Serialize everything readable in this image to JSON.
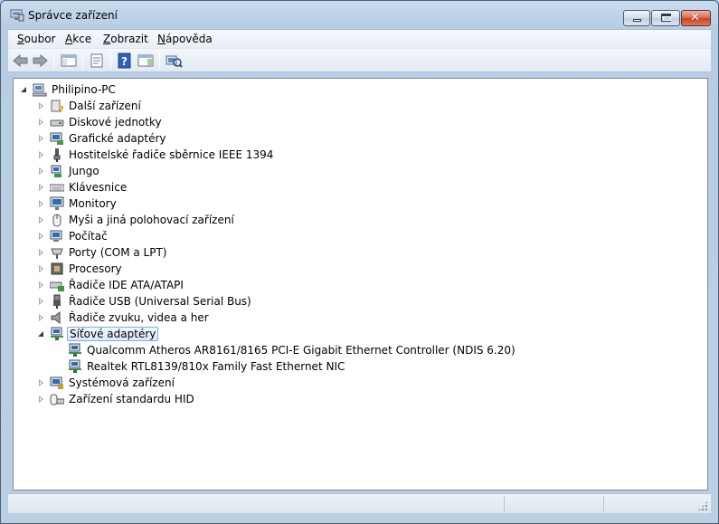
{
  "window": {
    "title": "Správce zařízení",
    "icons": [
      "device-manager-icon",
      "minimize-icon",
      "maximize-icon",
      "close-icon"
    ]
  },
  "menu": {
    "items": [
      {
        "label": "Soubor",
        "accel": "S"
      },
      {
        "label": "Akce",
        "accel": "A"
      },
      {
        "label": "Zobrazit",
        "accel": "Z"
      },
      {
        "label": "Nápověda",
        "accel": "N"
      }
    ]
  },
  "toolbar": {
    "buttons": [
      "back-icon",
      "forward-icon",
      "show-hide-console-tree-icon",
      "properties-icon",
      "help-icon",
      "action-pane-icon",
      "scan-hardware-icon"
    ]
  },
  "tree": {
    "root": {
      "label": "Philipino-PC",
      "icon": "computer-icon",
      "expanded": true
    },
    "categories": [
      {
        "label": "Další zařízení",
        "icon": "unknown-device-icon",
        "expanded": false
      },
      {
        "label": "Diskové jednotky",
        "icon": "disk-drive-icon",
        "expanded": false
      },
      {
        "label": "Grafické adaptéry",
        "icon": "display-adapter-icon",
        "expanded": false
      },
      {
        "label": "Hostitelské řadiče sběrnice IEEE 1394",
        "icon": "ieee1394-icon",
        "expanded": false
      },
      {
        "label": "Jungo",
        "icon": "jungo-icon",
        "expanded": false
      },
      {
        "label": "Klávesnice",
        "icon": "keyboard-icon",
        "expanded": false
      },
      {
        "label": "Monitory",
        "icon": "monitor-icon",
        "expanded": false
      },
      {
        "label": "Myši a jiná polohovací zařízení",
        "icon": "mouse-icon",
        "expanded": false
      },
      {
        "label": "Počítač",
        "icon": "computer-icon",
        "expanded": false
      },
      {
        "label": "Porty (COM a LPT)",
        "icon": "port-icon",
        "expanded": false
      },
      {
        "label": "Procesory",
        "icon": "processor-icon",
        "expanded": false
      },
      {
        "label": "Řadiče IDE ATA/ATAPI",
        "icon": "ide-controller-icon",
        "expanded": false
      },
      {
        "label": "Řadiče USB (Universal Serial Bus)",
        "icon": "usb-icon",
        "expanded": false
      },
      {
        "label": "Řadiče zvuku, videa a her",
        "icon": "sound-icon",
        "expanded": false
      },
      {
        "label": "Síťové adaptéry",
        "icon": "network-adapter-icon",
        "expanded": true,
        "selected": true,
        "children": [
          {
            "label": "Qualcomm Atheros AR8161/8165 PCI-E Gigabit Ethernet Controller (NDIS 6.20)",
            "icon": "network-adapter-icon"
          },
          {
            "label": "Realtek RTL8139/810x Family Fast Ethernet NIC",
            "icon": "network-adapter-icon"
          }
        ]
      },
      {
        "label": "Systémová zařízení",
        "icon": "system-device-icon",
        "expanded": false
      },
      {
        "label": "Zařízení standardu HID",
        "icon": "hid-icon",
        "expanded": false
      }
    ]
  },
  "colors": {
    "selection_border": "#84acdd",
    "window_frame": "#b9cde2"
  }
}
